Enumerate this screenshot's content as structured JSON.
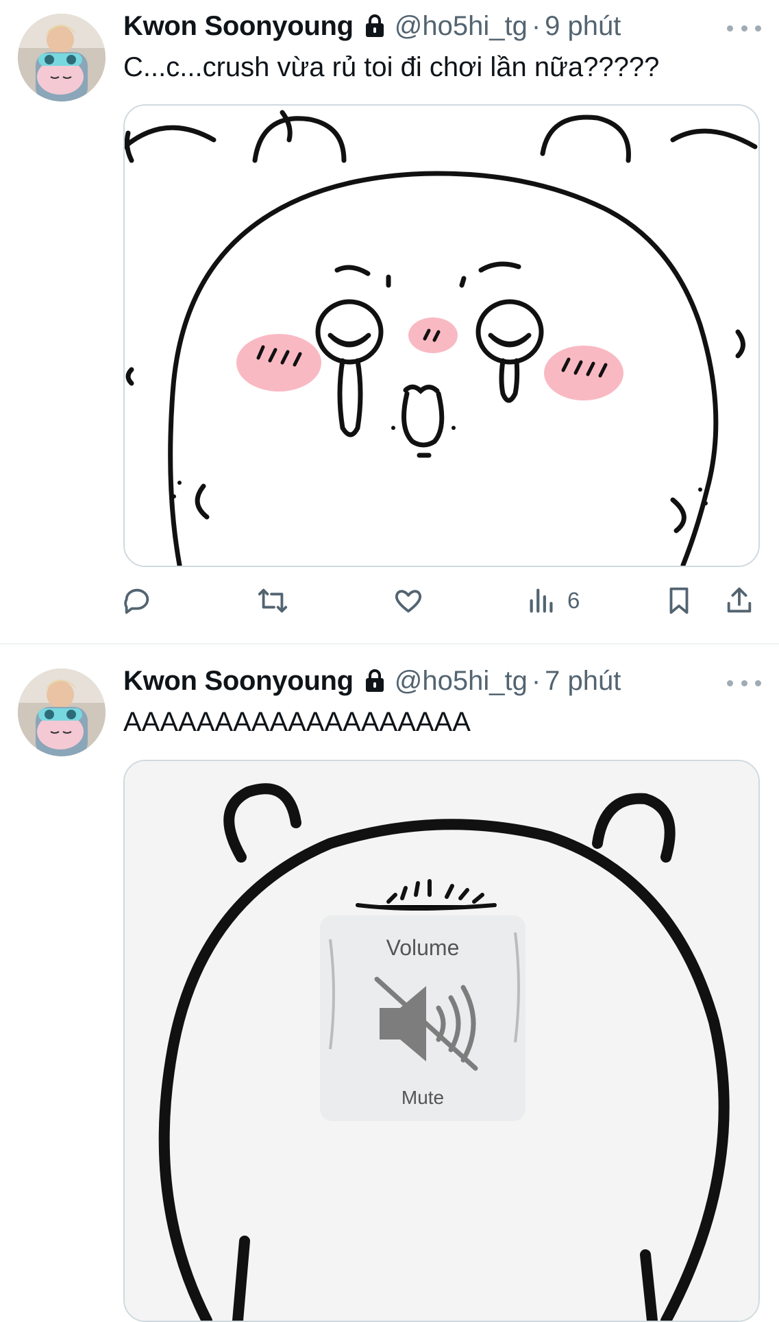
{
  "tweets": [
    {
      "author": "Kwon Soonyoung",
      "handle": "@ho5hi_tg",
      "separator": "·",
      "time": "9 phút",
      "text": "C...c...crush vừa rủ toi đi chơi lần nữa?????",
      "views": "6"
    },
    {
      "author": "Kwon Soonyoung",
      "handle": "@ho5hi_tg",
      "separator": "·",
      "time": "7 phút",
      "text": "AAAAAAAAAAAAAAAAAAA",
      "media_text": {
        "top": "Volume",
        "bottom": "Mute"
      }
    }
  ],
  "icons": {
    "lock": "lock-icon",
    "more": "more-icon",
    "reply": "reply-icon",
    "retweet": "retweet-icon",
    "like": "heart-icon",
    "views": "views-icon",
    "bookmark": "bookmark-icon",
    "share": "share-icon"
  },
  "colors": {
    "text": "#0f1419",
    "secondary": "#536471",
    "border": "#cfd9de",
    "blush": "#f9b9c3"
  }
}
